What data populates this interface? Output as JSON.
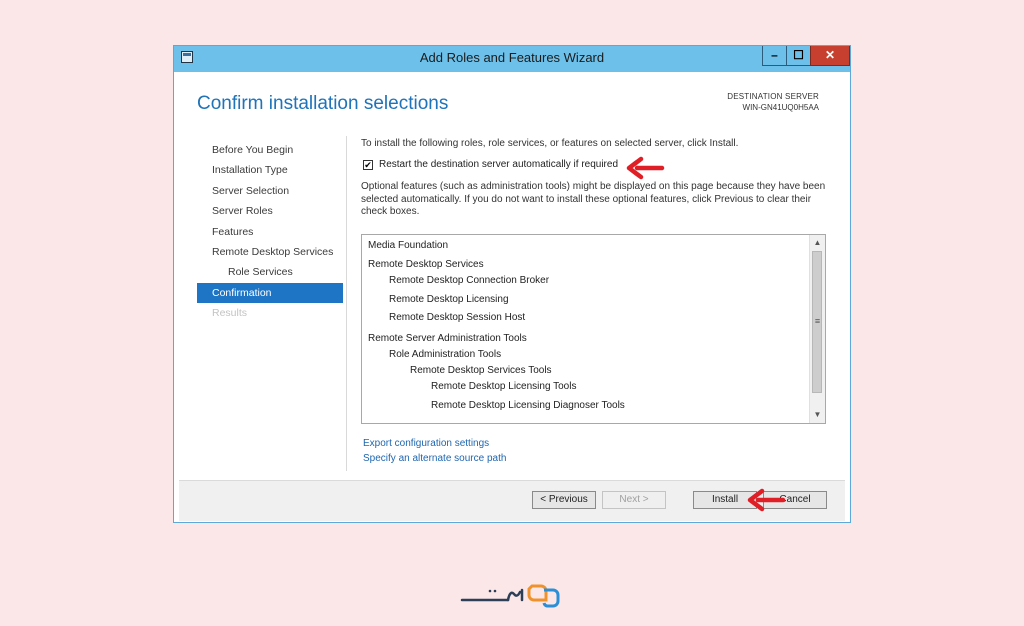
{
  "window": {
    "title": "Add Roles and Features Wizard",
    "controls": {
      "minimize": "–",
      "maximize": "☐",
      "close": "✕"
    }
  },
  "header": {
    "heading": "Confirm installation selections",
    "destination_label": "DESTINATION SERVER",
    "destination_server": "WIN-GN41UQ0H5AA"
  },
  "nav": {
    "items": [
      {
        "label": "Before You Begin",
        "state": "normal"
      },
      {
        "label": "Installation Type",
        "state": "normal"
      },
      {
        "label": "Server Selection",
        "state": "normal"
      },
      {
        "label": "Server Roles",
        "state": "normal"
      },
      {
        "label": "Features",
        "state": "normal"
      },
      {
        "label": "Remote Desktop Services",
        "state": "normal"
      },
      {
        "label": "Role Services",
        "state": "sub"
      },
      {
        "label": "Confirmation",
        "state": "selected"
      },
      {
        "label": "Results",
        "state": "disabled"
      }
    ]
  },
  "main": {
    "intro": "To install the following roles, role services, or features on selected server, click Install.",
    "restart": {
      "checked": true,
      "check_mark": "✔",
      "label": "Restart the destination server automatically if required"
    },
    "optional_note": "Optional features (such as administration tools) might be displayed on this page because they have been selected automatically. If you do not want to install these optional features, click Previous to clear their check boxes.",
    "selections": [
      {
        "text": "Media Foundation",
        "level": 0
      },
      {
        "text": "Remote Desktop Services",
        "level": 0
      },
      {
        "text": "Remote Desktop Connection Broker",
        "level": 1
      },
      {
        "text": "Remote Desktop Licensing",
        "level": 1
      },
      {
        "text": "Remote Desktop Session Host",
        "level": 1
      },
      {
        "text": "Remote Server Administration Tools",
        "level": 0
      },
      {
        "text": "Role Administration Tools",
        "level": 1
      },
      {
        "text": "Remote Desktop Services Tools",
        "level": 2
      },
      {
        "text": "Remote Desktop Licensing Tools",
        "level": 3
      },
      {
        "text": "Remote Desktop Licensing Diagnoser Tools",
        "level": 3
      }
    ],
    "scroll": {
      "up": "▲",
      "down": "▼",
      "grip": "≡"
    },
    "links": {
      "export": "Export configuration settings",
      "alternate_source": "Specify an alternate source path"
    }
  },
  "footer": {
    "previous": "< Previous",
    "next": "Next >",
    "install": "Install",
    "cancel": "Cancel"
  },
  "colors": {
    "accent": "#1e75c6",
    "titlebar": "#6cc0ea",
    "annotation_arrow": "#e01e25",
    "background": "#fbe7e8"
  }
}
